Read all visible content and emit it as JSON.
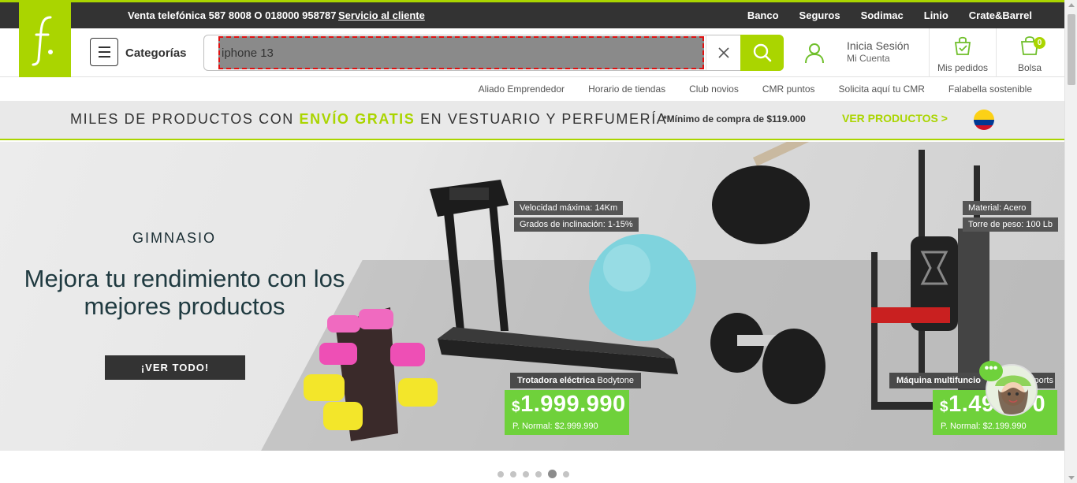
{
  "topbar": {
    "phone": "Venta telefónica 587 8008 O 018000 958787",
    "service": "Servicio al cliente",
    "links": [
      "Banco",
      "Seguros",
      "Sodimac",
      "Linio",
      "Crate&Barrel"
    ]
  },
  "header": {
    "categories_label": "Categorías",
    "search_value": "iphone 13",
    "login_title": "Inicia Sesión",
    "login_sub": "Mi Cuenta",
    "orders_label": "Mis pedidos",
    "bag_label": "Bolsa",
    "bag_count": "0"
  },
  "subnav": [
    "Aliado Emprendedor",
    "Horario de tiendas",
    "Club novios",
    "CMR puntos",
    "Solicita aquí tu CMR",
    "Falabella sostenible"
  ],
  "promo": {
    "text_before": "MILES DE PRODUCTOS CON ",
    "text_highlight": "ENVÍO GRATIS",
    "text_after": " EN VESTUARIO Y PERFUMERÍA",
    "minimum": "*Mínimo de compra de $119.000",
    "cta": "VER PRODUCTOS >"
  },
  "hero": {
    "category": "GIMNASIO",
    "title": "Mejora tu rendimiento con los mejores productos",
    "button": "¡VER TODO!",
    "treadmill_specs": [
      "Velocidad máxima: 14Km",
      "Grados de inclinación: 1-15%"
    ],
    "gym_specs": [
      "Material: Acero",
      "Torre de peso: 100 Lb"
    ],
    "product1_name_bold": "Trotadora eléctrica",
    "product1_name": " Bodytone",
    "product1_price": "1.999.990",
    "product1_normal": "P. Normal: $2.999.990",
    "product2_name_bold": "Máquina multifuncio",
    "product2_name_tail": "ports",
    "product2_price_a": "1.49",
    "product2_price_b": "0",
    "product2_normal": "P. Normal: $2.199.990",
    "currency": "$"
  },
  "carousel": {
    "count": 6,
    "active": 5
  },
  "colors": {
    "brand_green": "#aad500",
    "price_green": "#6fd13b",
    "dark": "#333333"
  }
}
